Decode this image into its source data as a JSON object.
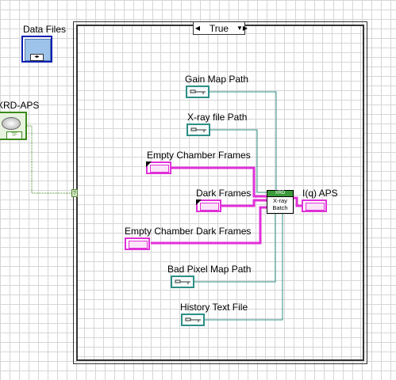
{
  "controls": {
    "data_files": {
      "label": "Data Files"
    },
    "xrd_aps": {
      "label": "XRD-APS",
      "value": "TF"
    }
  },
  "case_structure": {
    "selector_value": "True",
    "tunnel_glyph": "?"
  },
  "terminals": {
    "gain_map_path": "Gain Map Path",
    "xray_file_path": "X-ray file Path",
    "empty_chamber_frames": "Empty Chamber Frames",
    "dark_frames": "Dark Frames",
    "empty_chamber_dark_frames": "Empty Chamber Dark Frames",
    "bad_pixel_map_path": "Bad Pixel Map Path",
    "history_text_file": "History Text File",
    "iq_aps": "I(q) APS"
  },
  "subvi": {
    "header": "XRD",
    "line1": "X-ray",
    "line2": "Batch"
  },
  "colors": {
    "path_wire": "#2f8f86",
    "cluster_wire": "#e030d8",
    "boolean_wire": "#3a8a1a",
    "case_border": "#333333"
  }
}
